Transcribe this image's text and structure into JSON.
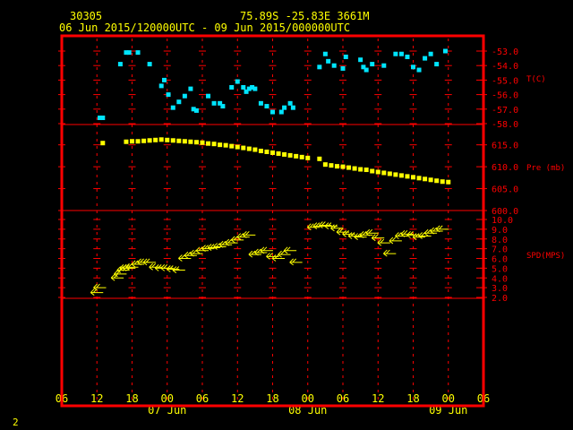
{
  "header": {
    "station": "30305",
    "location": "75.89S   -25.83E   3661M",
    "time_range": "06 Jun 2015/120000UTC - 09 Jun 2015/000000UTC"
  },
  "footer": {
    "page_number": "2"
  },
  "colors": {
    "background": "#000000",
    "frame": "#ff0000",
    "labels": "#ffff00",
    "temperature": "#00e5ff",
    "pressure": "#ffff00",
    "wind": "#ffff00",
    "panel_labels": "#ff0000"
  },
  "chart_data": {
    "type": "scatter",
    "x_axis": {
      "unit": "hours since 06 Jun 00 UTC",
      "range": [
        6,
        78
      ],
      "ticks": [
        6,
        12,
        18,
        24,
        30,
        36,
        42,
        48,
        54,
        60,
        66,
        72,
        78
      ],
      "tick_labels": [
        "06",
        "12",
        "18",
        "00",
        "06",
        "12",
        "18",
        "00",
        "06",
        "12",
        "18",
        "00",
        "06"
      ],
      "date_labels": [
        {
          "x": 24,
          "text": "07 Jun"
        },
        {
          "x": 48,
          "text": "08 Jun"
        },
        {
          "x": 72,
          "text": "09 Jun"
        }
      ]
    },
    "panels": [
      {
        "name": "temperature",
        "label": "T(C)",
        "range": [
          -58.0,
          -53.0
        ],
        "ticks": [
          -53.0,
          -54.0,
          -55.0,
          -56.0,
          -57.0,
          -58.0
        ],
        "tick_labels": [
          "-53.0",
          "-54.0",
          "-55.0",
          "-56.0",
          "-57.0",
          "-58.0"
        ],
        "marker": "square",
        "x": [
          12.5,
          13.0,
          16.0,
          17.0,
          17.5,
          19.0,
          21.0,
          23.0,
          23.5,
          24.2,
          25.0,
          26.0,
          27.0,
          28.0,
          28.5,
          29.0,
          31.0,
          32.0,
          33.0,
          33.5,
          35.0,
          36.0,
          37.0,
          37.5,
          38.0,
          38.5,
          39.0,
          40.0,
          41.0,
          42.0,
          43.5,
          44.0,
          45.0,
          45.5,
          50.0,
          51.0,
          51.5,
          52.5,
          54.0,
          54.5,
          57.0,
          57.5,
          58.0,
          59.0,
          61.0,
          63.0,
          64.0,
          65.0,
          66.0,
          67.0,
          68.0,
          69.0,
          70.0,
          71.5
        ],
        "values": [
          -57.6,
          -57.6,
          -53.9,
          -53.1,
          -53.1,
          -53.1,
          -53.9,
          -55.4,
          -55.0,
          -56.0,
          -56.9,
          -56.5,
          -56.1,
          -55.6,
          -57.0,
          -57.1,
          -56.1,
          -56.6,
          -56.6,
          -56.8,
          -55.5,
          -55.1,
          -55.5,
          -55.8,
          -55.6,
          -55.5,
          -55.6,
          -56.6,
          -56.8,
          -57.2,
          -57.2,
          -56.9,
          -56.6,
          -56.9,
          -54.1,
          -53.2,
          -53.7,
          -54.0,
          -54.2,
          -53.4,
          -53.6,
          -54.1,
          -54.3,
          -53.9,
          -54.0,
          -53.2,
          -53.2,
          -53.4,
          -54.1,
          -54.3,
          -53.5,
          -53.2,
          -53.9,
          -53.0
        ]
      },
      {
        "name": "pressure",
        "label": "Pre (mb)",
        "range": [
          600.0,
          618.0
        ],
        "ticks": [
          615.0,
          610.0,
          605.0,
          600.0
        ],
        "tick_labels": [
          "615.0",
          "610.0",
          "605.0",
          "600.0"
        ],
        "marker": "square",
        "x": [
          13,
          17,
          18,
          19,
          20,
          21,
          22,
          23,
          24,
          25,
          26,
          27,
          28,
          29,
          30,
          31,
          32,
          33,
          34,
          35,
          36,
          37,
          38,
          39,
          40,
          41,
          42,
          43,
          44,
          45,
          46,
          47,
          48,
          50,
          51,
          52,
          53,
          54,
          55,
          56,
          57,
          58,
          59,
          60,
          61,
          62,
          63,
          64,
          65,
          66,
          67,
          68,
          69,
          70,
          71,
          72
        ],
        "values": [
          615.4,
          615.7,
          615.8,
          615.8,
          615.9,
          616.0,
          616.1,
          616.2,
          616.1,
          616.0,
          615.9,
          615.8,
          615.7,
          615.6,
          615.5,
          615.3,
          615.2,
          615.0,
          614.9,
          614.7,
          614.5,
          614.3,
          614.1,
          613.9,
          613.6,
          613.4,
          613.2,
          613.0,
          612.8,
          612.6,
          612.4,
          612.2,
          612.0,
          611.8,
          610.5,
          610.3,
          610.1,
          610.0,
          609.8,
          609.6,
          609.4,
          609.3,
          609.0,
          608.8,
          608.6,
          608.4,
          608.2,
          608.0,
          607.8,
          607.6,
          607.4,
          607.2,
          607.0,
          606.8,
          606.6,
          606.5
        ]
      },
      {
        "name": "wind",
        "label": "SPD(MPS)",
        "range": [
          2.0,
          10.0
        ],
        "ticks": [
          10.0,
          9.0,
          8.0,
          7.0,
          6.0,
          5.0,
          4.0,
          3.0,
          2.0
        ],
        "tick_labels": [
          "10.0",
          "9.0",
          "8.0",
          "7.0",
          "6.0",
          "5.0",
          "4.0",
          "3.0",
          "2.0"
        ],
        "marker": "wind-barb",
        "x": [
          12,
          12.5,
          15.5,
          16,
          16.5,
          17,
          17.5,
          18,
          19,
          20,
          21,
          22,
          23,
          24,
          25,
          26,
          27,
          28,
          29,
          30,
          31,
          32,
          33,
          34,
          35,
          36,
          37,
          38,
          39,
          40,
          41,
          42,
          43,
          44,
          45,
          46,
          49,
          50,
          51,
          52,
          53,
          54,
          55,
          56,
          57,
          58,
          59,
          60,
          61,
          62,
          63,
          64,
          65,
          66,
          67,
          68,
          69,
          70,
          71
        ],
        "values": [
          2.5,
          3.0,
          4.0,
          4.4,
          4.8,
          5.0,
          5.0,
          5.1,
          5.4,
          5.6,
          5.6,
          5.1,
          5.0,
          5.0,
          4.9,
          4.8,
          6.0,
          6.3,
          6.5,
          6.8,
          7.0,
          7.1,
          7.2,
          7.4,
          7.6,
          7.9,
          8.2,
          8.4,
          6.4,
          6.6,
          6.8,
          6.2,
          6.0,
          6.4,
          6.8,
          5.6,
          9.2,
          9.3,
          9.4,
          9.3,
          9.1,
          8.7,
          8.5,
          8.3,
          8.2,
          8.4,
          8.6,
          8.1,
          7.6,
          6.5,
          7.8,
          8.3,
          8.5,
          8.4,
          8.2,
          8.3,
          8.6,
          8.8,
          9.0
        ]
      }
    ]
  }
}
